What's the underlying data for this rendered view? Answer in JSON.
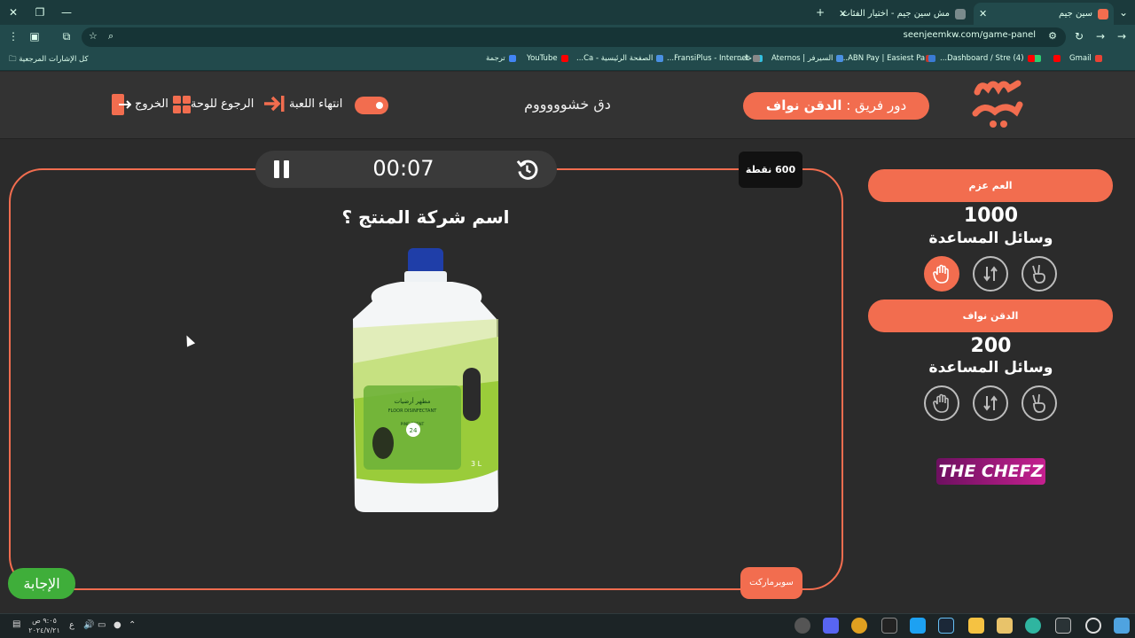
{
  "browser": {
    "tabs": [
      {
        "label": "سين جيم",
        "active": true
      },
      {
        "label": "مش سين جيم - اختيار الفئات",
        "active": false
      }
    ],
    "new_tab": "+",
    "url": "seenjeemkw.com/game-panel",
    "bookmarks": [
      {
        "label": "Gmail",
        "color": "#ea4335"
      },
      {
        "label": "",
        "color": "#ff0000"
      },
      {
        "label": "",
        "color": "#2ecc71"
      },
      {
        "label": "(4) Dashboard / Stre...",
        "color": "#ff0000"
      },
      {
        "label": "",
        "color": "#c0392b"
      },
      {
        "label": "ABN Pay | Easiest Pa...",
        "color": "#3a7bd5"
      },
      {
        "label": "السيرفر | Aternos",
        "color": "#4a90e2"
      },
      {
        "label": "خا...",
        "color": "#34c0e0"
      },
      {
        "label": "FransiPlus - Internet...",
        "color": "#888"
      },
      {
        "label": "الصفحة الرئيسية - Ca...",
        "color": "#4a90e2"
      },
      {
        "label": "YouTube",
        "color": "#ff0000"
      },
      {
        "label": "ترجمة",
        "color": "#4285f4"
      }
    ],
    "all_bookmarks": "كل الإشارات المرجعية"
  },
  "header": {
    "logo_text": "سين جيم",
    "turn_prefix": "دور فريق :",
    "turn_team": "الدقن نواف",
    "shout": "دق خشوووووم",
    "end_game": "انتهاء اللعبة",
    "back_board": "الرجوع للوحة",
    "exit": "الخروج"
  },
  "game": {
    "timer": "00:07",
    "points": "600 نقطة",
    "question": "اسم شركة المنتج ؟",
    "category": "سوبرماركت",
    "answer_button": "الإجابة",
    "product_label_brand": "مطهر أرضيات",
    "product_label_en": "FLOOR DISINFECTANT",
    "product_label_scent": "PINE SCENT",
    "product_size": "3 L",
    "product_badge": "24"
  },
  "teams": [
    {
      "name": "العم عزم",
      "score": "1000",
      "helpers_title": "وسائل المساعدة",
      "helpers": [
        {
          "icon": "hand-stop-icon",
          "used": true
        },
        {
          "icon": "swap-arrows-icon",
          "used": false
        },
        {
          "icon": "victory-hand-icon",
          "used": false
        }
      ]
    },
    {
      "name": "الدقن نواف",
      "score": "200",
      "helpers_title": "وسائل المساعدة",
      "helpers": [
        {
          "icon": "hand-stop-icon",
          "used": false
        },
        {
          "icon": "swap-arrows-icon",
          "used": false
        },
        {
          "icon": "victory-hand-icon",
          "used": false
        }
      ]
    }
  ],
  "sponsor": "THE CHEFZ",
  "taskbar": {
    "time": "٩:٠٥ ص",
    "date": "٢٠٢٤/٧/٢١",
    "lang": "ع"
  },
  "colors": {
    "accent": "#f26d4f",
    "answer": "#3fae3a",
    "background": "#2b2b2b"
  }
}
